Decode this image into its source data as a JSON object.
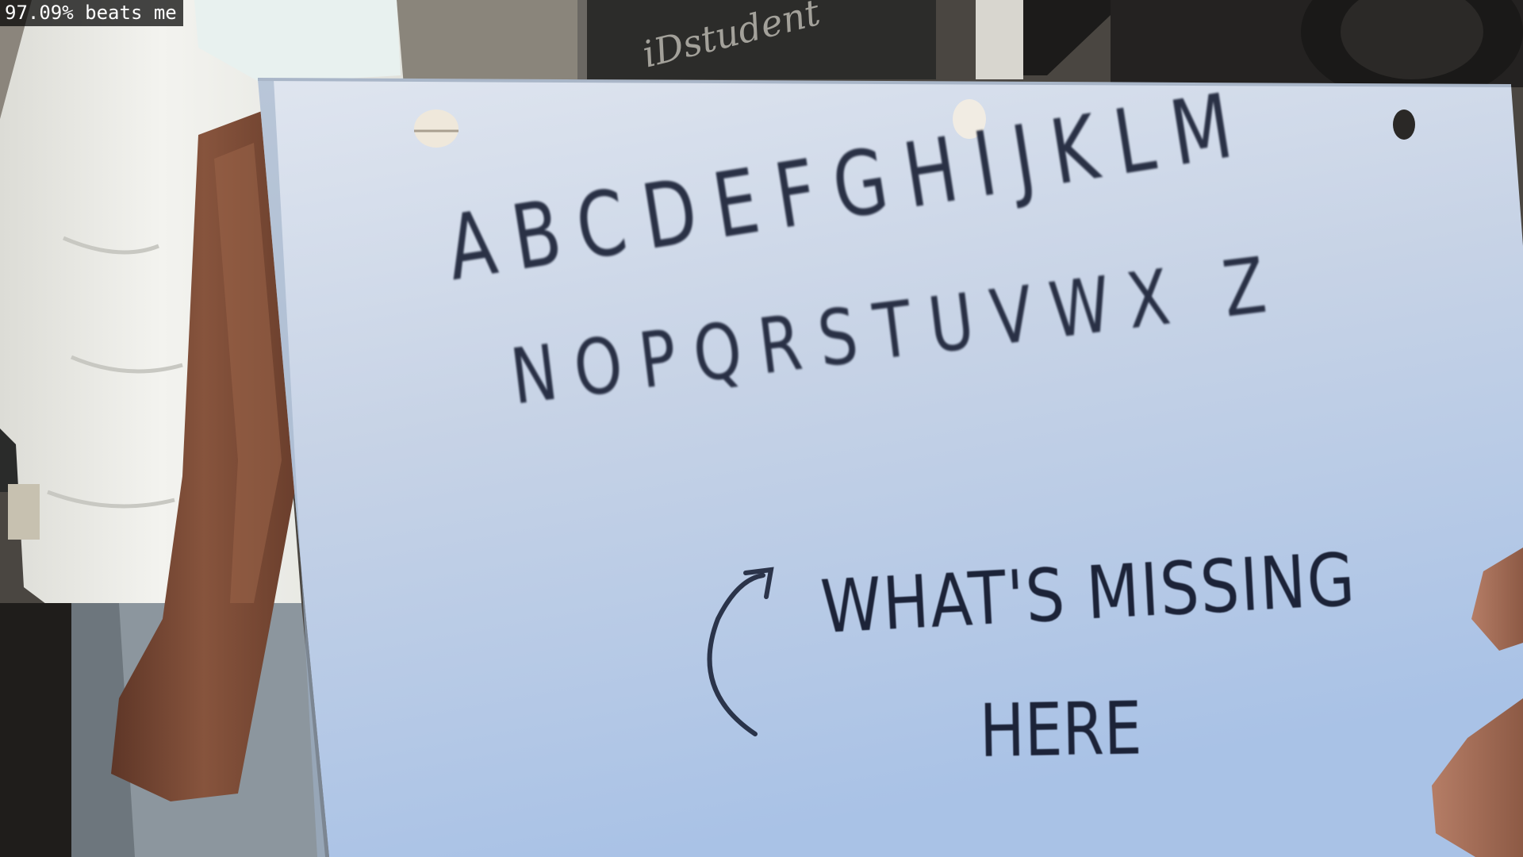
{
  "overlay": {
    "label": "97.09% beats me"
  },
  "sign": {
    "alphabet_row_1": "ABCDEFGHIJKLM",
    "alphabet_row_2": "NOPQRSTUVWX Z",
    "question_line_1": "WHAT'S MISSING",
    "question_line_2": "HERE",
    "background_text": "iDstudent"
  },
  "colors": {
    "paper": "#c9d6ea",
    "ink": "#1c2338",
    "shirt": "#eef0ee",
    "skin": "#7a4a36"
  }
}
